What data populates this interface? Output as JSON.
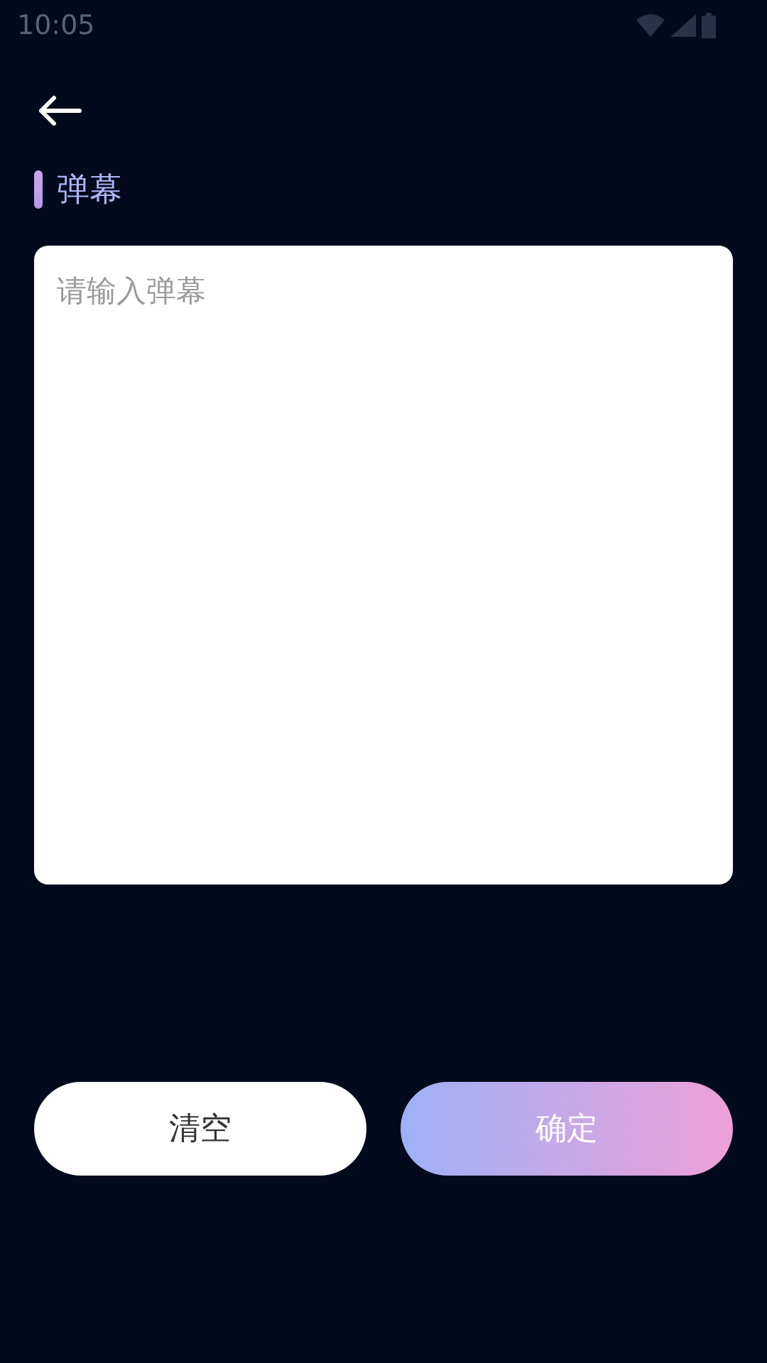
{
  "status_bar": {
    "time": "10:05"
  },
  "section": {
    "title": "弹幕"
  },
  "input": {
    "placeholder": "请输入弹幕"
  },
  "buttons": [
    {
      "label": "清空",
      "kind": "secondary"
    },
    {
      "label": "确定",
      "kind": "primary"
    }
  ]
}
